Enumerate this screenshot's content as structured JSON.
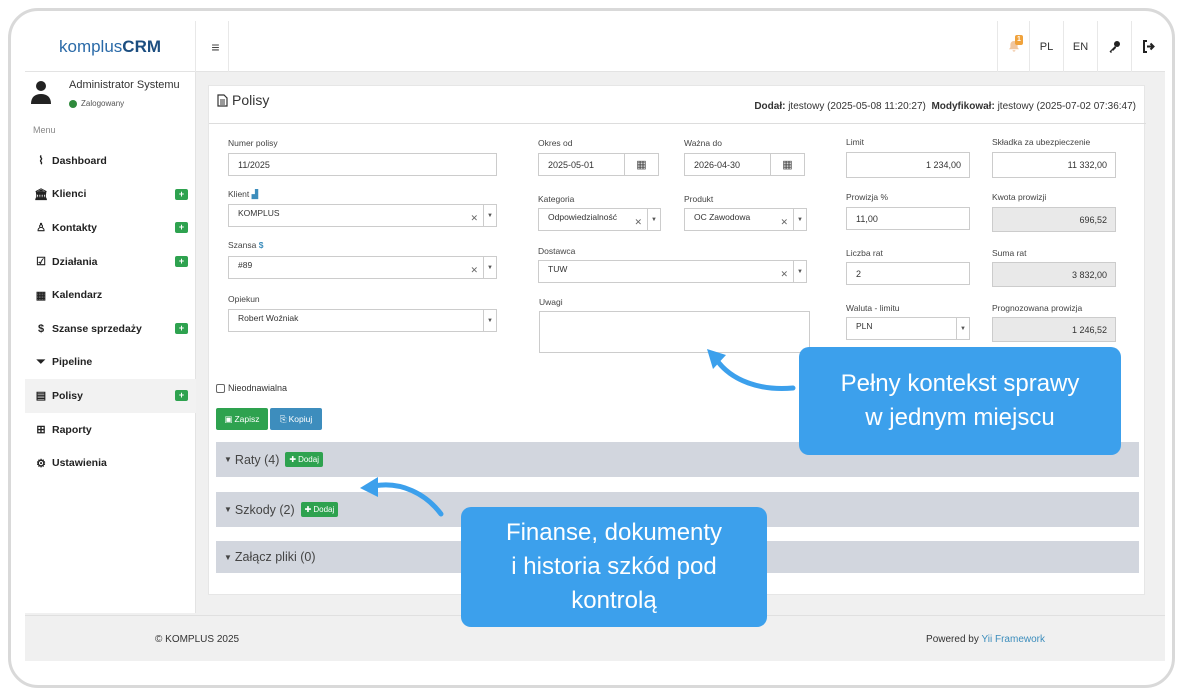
{
  "brand": {
    "prefix": "komplus",
    "suffix": "CRM"
  },
  "topbar": {
    "notif_count": "1",
    "lang_pl": "PL",
    "lang_en": "EN"
  },
  "user": {
    "name": "Administrator Systemu",
    "status": "Zalogowany"
  },
  "menu_label": "Menu",
  "nav": [
    {
      "label": "Dashboard",
      "icon": "chart-icon",
      "glyph": "⌇",
      "plus": false
    },
    {
      "label": "Klienci",
      "icon": "bank-icon",
      "glyph": "🏛",
      "plus": true
    },
    {
      "label": "Kontakty",
      "icon": "user-tie-icon",
      "glyph": "♙",
      "plus": true
    },
    {
      "label": "Działania",
      "icon": "check-square-icon",
      "glyph": "☑",
      "plus": true
    },
    {
      "label": "Kalendarz",
      "icon": "calendar-icon",
      "glyph": "▦",
      "plus": false
    },
    {
      "label": "Szanse sprzedaży",
      "icon": "dollar-icon",
      "glyph": "$",
      "plus": true
    },
    {
      "label": "Pipeline",
      "icon": "filter-icon",
      "glyph": "⏷",
      "plus": false
    },
    {
      "label": "Polisy",
      "icon": "document-icon",
      "glyph": "▤",
      "plus": true
    },
    {
      "label": "Raporty",
      "icon": "table-icon",
      "glyph": "⊞",
      "plus": false
    },
    {
      "label": "Ustawienia",
      "icon": "cogs-icon",
      "glyph": "⚙",
      "plus": false
    }
  ],
  "panel": {
    "title": "Polisy",
    "added_label": "Dodał:",
    "added_value": "jtestowy (2025-05-08 11:20:27)",
    "modified_label": "Modyfikował:",
    "modified_value": "jtestowy (2025-07-02 07:36:47)"
  },
  "form": {
    "numer_label": "Numer polisy",
    "numer": "11/2025",
    "klient_label": "Klient",
    "klient": "KOMPLUS",
    "szansa_label": "Szansa",
    "szansa": "#89",
    "opiekun_label": "Opiekun",
    "opiekun": "Robert Woźniak",
    "okres_label": "Okres od",
    "okres": "2025-05-01",
    "wazna_label": "Ważna do",
    "wazna": "2026-04-30",
    "kategoria_label": "Kategoria",
    "kategoria": "Odpowiedzialność",
    "produkt_label": "Produkt",
    "produkt": "OC Zawodowa",
    "dostawca_label": "Dostawca",
    "dostawca": "TUW",
    "uwagi_label": "Uwagi",
    "limit_label": "Limit",
    "limit": "1 234,00",
    "skladka_label": "Składka za ubezpieczenie",
    "skladka": "11 332,00",
    "prowizja_label": "Prowizja %",
    "prowizja": "11,00",
    "kwota_label": "Kwota prowizji",
    "kwota": "696,52",
    "liczba_label": "Liczba rat",
    "liczba": "2",
    "suma_label": "Suma rat",
    "suma": "3 832,00",
    "waluta_label": "Waluta - limitu",
    "waluta": "PLN",
    "prognoza_label": "Prognozowana prowizja",
    "prognoza": "1 246,52",
    "nieodnawialna": "Nieodnawialna"
  },
  "buttons": {
    "save": "Zapisz",
    "copy": "Kopiuj"
  },
  "sections": {
    "raty": "Raty (4)",
    "szkody": "Szkody (2)",
    "pliki": "Załącz pliki (0)",
    "add": "Dodaj"
  },
  "footer": {
    "copyright": "© KOMPLUS 2025",
    "powered": "Powered by",
    "framework": "Yii Framework"
  },
  "callouts": {
    "one_line1": "Pełny kontekst sprawy",
    "one_line2": "w jednym miejscu",
    "two_line1": "Finanse, dokumenty",
    "two_line2": "i historia szkód pod",
    "two_line3": "kontrolą",
    "color": "#3ca0ec"
  }
}
